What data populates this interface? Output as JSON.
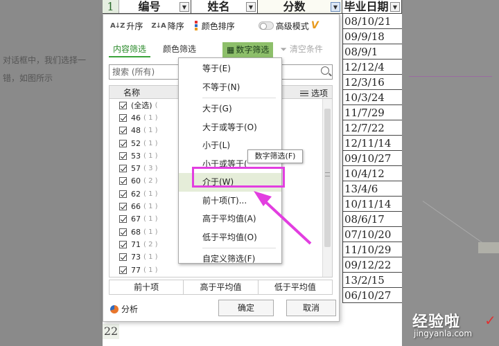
{
  "background": {
    "text_line_1": "对话框中，我们选择一",
    "text_line_2": "错，如图所示"
  },
  "sheet": {
    "row_number": "1",
    "headers": [
      "编号",
      "姓名",
      "分数",
      "毕业日期"
    ],
    "dates": [
      "08/10/21",
      "09/9/18",
      "08/9/1",
      "12/12/4",
      "12/3/16",
      "10/3/24",
      "11/7/29",
      "12/7/22",
      "12/11/14",
      "09/10/27",
      "10/4/12",
      "13/4/6",
      "10/11/14",
      "08/6/17",
      "07/10/20",
      "11/10/29",
      "09/12/22",
      "13/2/15",
      "06/10/27"
    ],
    "last_row_number": "22"
  },
  "toolbar": {
    "sort_asc": "升序",
    "sort_desc": "降序",
    "color_sort": "颜色排序",
    "advanced_mode": "高级模式"
  },
  "tabs": {
    "content_filter": "内容筛选",
    "color_filter": "颜色筛选",
    "number_filter": "数字筛选",
    "clear": "清空条件"
  },
  "search": {
    "placeholder": "搜索 (所有)"
  },
  "list": {
    "header_name": "名称",
    "header_options": "选项",
    "items": [
      {
        "label": "(全选)",
        "count": "("
      },
      {
        "label": "46",
        "count": "( 1 )"
      },
      {
        "label": "48",
        "count": "( 1 )"
      },
      {
        "label": "52",
        "count": "( 1 )"
      },
      {
        "label": "53",
        "count": "( 1 )"
      },
      {
        "label": "57",
        "count": "( 3 )"
      },
      {
        "label": "60",
        "count": "( 2 )"
      },
      {
        "label": "62",
        "count": "( 1 )"
      },
      {
        "label": "66",
        "count": "( 1 )"
      },
      {
        "label": "67",
        "count": "( 1 )"
      },
      {
        "label": "68",
        "count": "( 1 )"
      },
      {
        "label": "71",
        "count": "( 2 )"
      },
      {
        "label": "73",
        "count": "( 1 )"
      },
      {
        "label": "77",
        "count": "( 1 )"
      }
    ]
  },
  "bottom_buttons": [
    "前十项",
    "高于平均值",
    "低于平均值"
  ],
  "footer": {
    "analyze": "分析",
    "ok": "确定",
    "cancel": "取消"
  },
  "menu": {
    "items": [
      "等于(E)",
      "不等于(N)",
      "大于(G)",
      "大于或等于(O)",
      "小于(L)",
      "小于或等于(",
      "介于(W)",
      "前十项(T)...",
      "高于平均值(A)",
      "低于平均值(O)",
      "自定义筛选(F)"
    ]
  },
  "tooltip": "数字筛选(F)",
  "watermark": {
    "brand": "经验啦",
    "url": "jingyanla.com"
  },
  "colors": {
    "highlight": "#e23ee0",
    "accent_green": "#3aa43a",
    "number_tab_bg": "#8dbf6a"
  }
}
